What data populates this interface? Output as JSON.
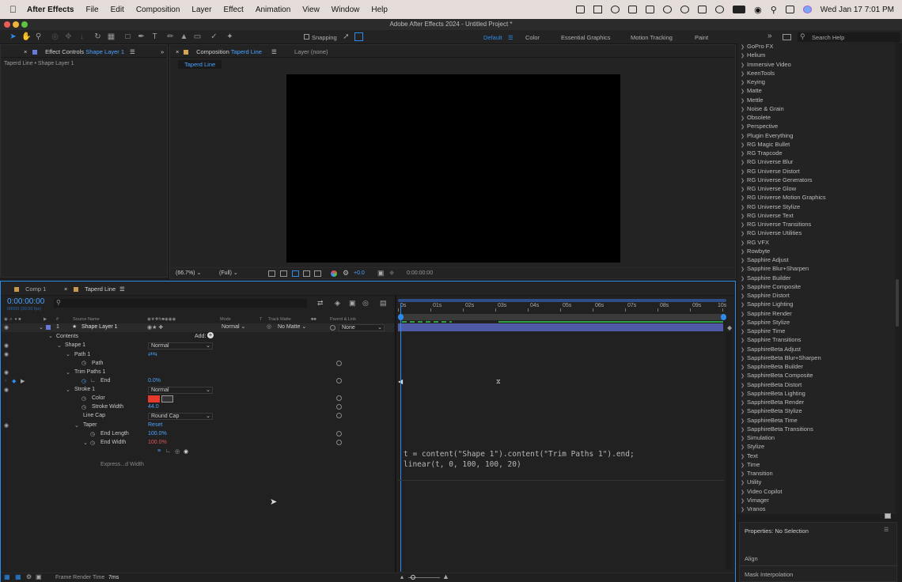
{
  "menubar": {
    "app": "After Effects",
    "items": [
      "File",
      "Edit",
      "Composition",
      "Layer",
      "Effect",
      "Animation",
      "View",
      "Window",
      "Help"
    ],
    "clock": "Wed Jan 17  7:01 PM"
  },
  "window": {
    "title": "Adobe After Effects 2024 - Untitled Project *"
  },
  "toolbar": {
    "snapping": "Snapping",
    "workspaces": [
      "Default",
      "Color",
      "Essential Graphics",
      "Motion Tracking",
      "Paint"
    ],
    "search_placeholder": "Search Help"
  },
  "effect_controls": {
    "tab": "Effect Controls",
    "layer": "Shape Layer 1",
    "breadcrumb": "Taperd Line • Shape Layer 1"
  },
  "composition": {
    "tab_prefix": "Composition",
    "tab_name": "Taperd Line",
    "layer_tab": "Layer (none)",
    "subtab": "Taperd Line",
    "zoom": "(66.7%)",
    "resolution": "(Full)",
    "exposure": "+0.0",
    "timecode": "0:00:00:00"
  },
  "effects_list": [
    "GoPro FX",
    "Helium",
    "Immersive Video",
    "KeenTools",
    "Keying",
    "Matte",
    "Mettle",
    "Noise & Grain",
    "Obsolete",
    "Perspective",
    "Plugin Everything",
    "RG Magic Bullet",
    "RG Trapcode",
    "RG Universe Blur",
    "RG Universe Distort",
    "RG Universe Generators",
    "RG Universe Glow",
    "RG Universe Motion Graphics",
    "RG Universe Stylize",
    "RG Universe Text",
    "RG Universe Transitions",
    "RG Universe Utilities",
    "RG VFX",
    "Rowbyte",
    "Sapphire Adjust",
    "Sapphire Blur+Sharpen",
    "Sapphire Builder",
    "Sapphire Composite",
    "Sapphire Distort",
    "Sapphire Lighting",
    "Sapphire Render",
    "Sapphire Stylize",
    "Sapphire Time",
    "Sapphire Transitions",
    "SapphireBeta Adjust",
    "SapphireBeta Blur+Sharpen",
    "SapphireBeta Builder",
    "SapphireBeta Composite",
    "SapphireBeta Distort",
    "SapphireBeta Lighting",
    "SapphireBeta Render",
    "SapphireBeta Stylize",
    "SapphireBeta Time",
    "SapphireBeta Transitions",
    "Simulation",
    "Stylize",
    "Text",
    "Time",
    "Transition",
    "Utility",
    "Video Copilot",
    "Vimager",
    "Vranos"
  ],
  "properties": {
    "title": "Properties: No Selection",
    "align": "Align",
    "mask": "Mask Interpolation"
  },
  "timeline": {
    "tabs": [
      "Comp 1",
      "Taperd Line"
    ],
    "timecode": "0:00:00:00",
    "fps": "00000 (30.00 fps)",
    "headers": {
      "source": "Source Name",
      "mode": "Mode",
      "t": "T",
      "trackmatte": "Track Matte",
      "parent": "Parent & Link"
    },
    "ruler": [
      "0s",
      "01s",
      "02s",
      "03s",
      "04s",
      "05s",
      "06s",
      "07s",
      "08s",
      "09s",
      "10s"
    ],
    "layer": {
      "num": "1",
      "name": "Shape Layer 1",
      "mode": "Normal",
      "matte": "No Matte",
      "parent": "None"
    },
    "contents": "Contents",
    "add": "Add:",
    "shape1": "Shape 1",
    "shape1_mode": "Normal",
    "path1": "Path 1",
    "path": "Path",
    "trim": "Trim Paths 1",
    "end": "End",
    "end_val": "0.0%",
    "stroke": "Stroke 1",
    "stroke_mode": "Normal",
    "color": "Color",
    "stroke_width": "Stroke Width",
    "stroke_width_val": "44.0",
    "linecap": "Line Cap",
    "linecap_val": "Round Cap",
    "taper": "Taper",
    "reset": "Reset",
    "end_length": "End Length",
    "end_length_val": "100.0%",
    "end_width": "End Width",
    "end_width_val": "100.0%",
    "expr_label": "Express...d Width",
    "expression": [
      "t = content(\"Shape 1\").content(\"Trim Paths 1\").end;",
      "linear(t, 0, 100, 100, 20)"
    ],
    "status": "Frame Render Time",
    "render_time": "7ms"
  }
}
